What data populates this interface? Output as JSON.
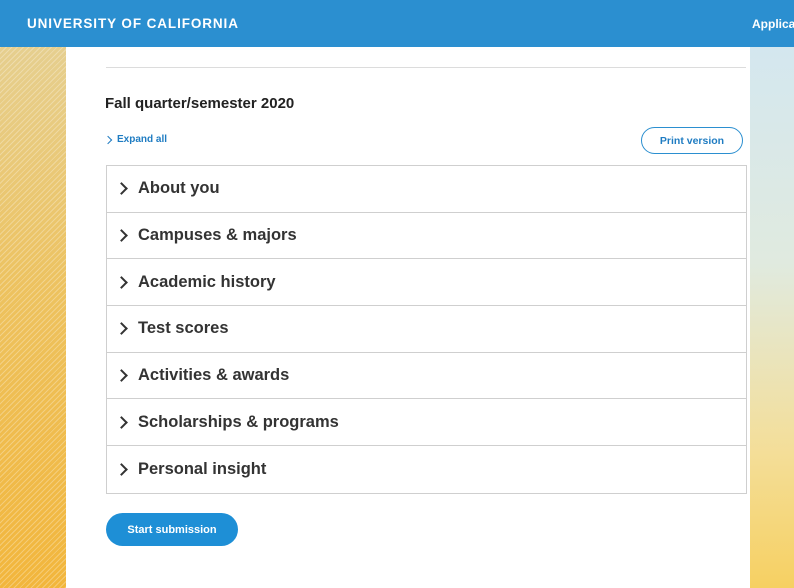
{
  "header": {
    "brand": "UNIVERSITY OF CALIFORNIA",
    "right_link": "Applicat"
  },
  "main": {
    "term_title": "Fall quarter/semester 2020",
    "expand_all_label": "Expand all",
    "print_version_label": "Print version",
    "sections": [
      {
        "label": "About you"
      },
      {
        "label": "Campuses & majors"
      },
      {
        "label": "Academic history"
      },
      {
        "label": "Test scores"
      },
      {
        "label": "Activities & awards"
      },
      {
        "label": "Scholarships & programs"
      },
      {
        "label": "Personal insight"
      }
    ],
    "start_submission_label": "Start submission"
  },
  "colors": {
    "header_blue": "#2b8fd0",
    "button_blue": "#1e8fd6",
    "link_blue": "#1f7cc2",
    "gold_accent": "#f2b63c"
  },
  "icons": {
    "expand_all": "chevron-right-icon",
    "section_toggle": "chevron-right-icon"
  }
}
